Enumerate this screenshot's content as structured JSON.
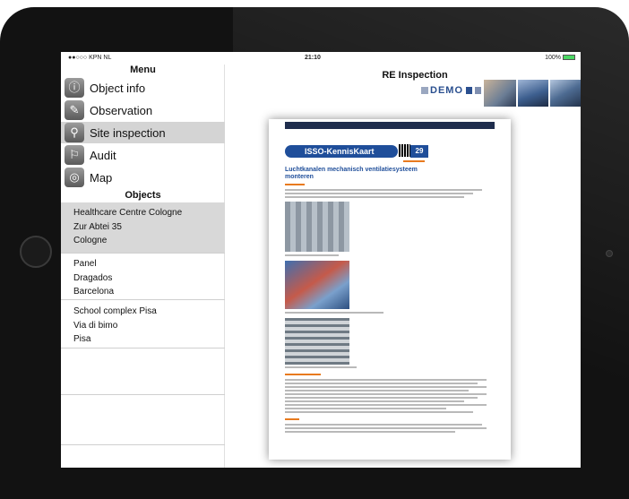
{
  "statusbar": {
    "carrier": "●●○○○ KPN NL",
    "time": "21:10",
    "battery": "100%"
  },
  "sidebar": {
    "menu_title": "Menu",
    "menu_items": [
      {
        "label": "Object info",
        "icon": "object-info-icon",
        "glyph": "ⓘ"
      },
      {
        "label": "Observation",
        "icon": "pencil-icon",
        "glyph": "✎"
      },
      {
        "label": "Site inspection",
        "icon": "magnifier-icon",
        "glyph": "⚲"
      },
      {
        "label": "Audit",
        "icon": "audit-icon",
        "glyph": "⚐"
      },
      {
        "label": "Map",
        "icon": "map-icon",
        "glyph": "◎"
      }
    ],
    "active_menu_item": "Site inspection",
    "objects_title": "Objects",
    "objects": [
      {
        "name": "Healthcare Centre Cologne",
        "street": "Zur Abtei 35",
        "city": "Cologne"
      },
      {
        "name": "Panel",
        "street": "Dragados",
        "city": "Barcelona"
      },
      {
        "name": "School complex Pisa",
        "street": "Via di bimo",
        "city": "Pisa"
      }
    ]
  },
  "main": {
    "title": "RE Inspection",
    "banner_text": "DEMO",
    "document": {
      "header": "ISSO-KennisKaart",
      "number": "29",
      "title": "Luchtkanalen mechanisch ventilatiesysteem monteren"
    }
  },
  "colors": {
    "bezel": "#121212",
    "brand_blue": "#1f4e9a",
    "active_row": "#d4d4d4",
    "accent_orange": "#e87a1e"
  }
}
